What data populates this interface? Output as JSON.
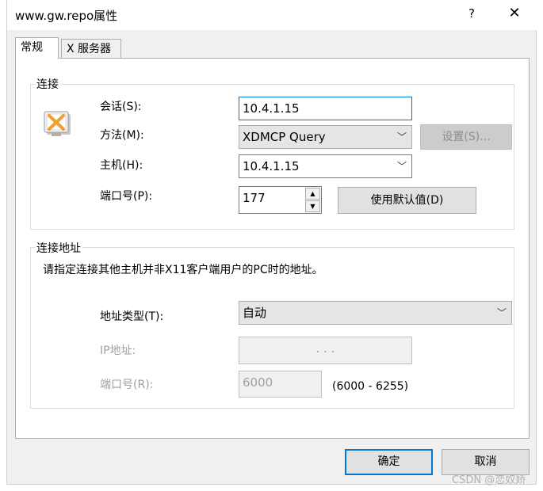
{
  "window": {
    "title": "www.gw.repo属性",
    "help": "?",
    "close": "✕"
  },
  "tabs": [
    {
      "label": "常规",
      "active": true
    },
    {
      "label": "X 服务器",
      "active": false
    }
  ],
  "connection": {
    "group_title": "连接",
    "session_label": "会话(S):",
    "session_value": "10.4.1.15",
    "method_label": "方法(M):",
    "method_value": "XDMCP Query",
    "settings_button": "设置(S)...",
    "host_label": "主机(H):",
    "host_value": "10.4.1.15",
    "port_label": "端口号(P):",
    "port_value": "177",
    "default_button": "使用默认值(D)"
  },
  "address": {
    "group_title": "连接地址",
    "description": "请指定连接其他主机并非X11客户端用户的PC时的地址。",
    "type_label": "地址类型(T):",
    "type_value": "自动",
    "ip_label": "IP地址:",
    "ip_value": ".          .          .",
    "port_label": "端口号(R):",
    "port_value": "6000",
    "port_range": "(6000 - 6255)"
  },
  "footer": {
    "ok": "确定",
    "cancel": "取消"
  },
  "watermark": "CSDN @恋奴娇",
  "colors": {
    "focus": "#0078d7",
    "dialog_bg": "#f0f0f0",
    "panel_bg": "#ffffff",
    "disabled_text": "#a0a0a0"
  }
}
